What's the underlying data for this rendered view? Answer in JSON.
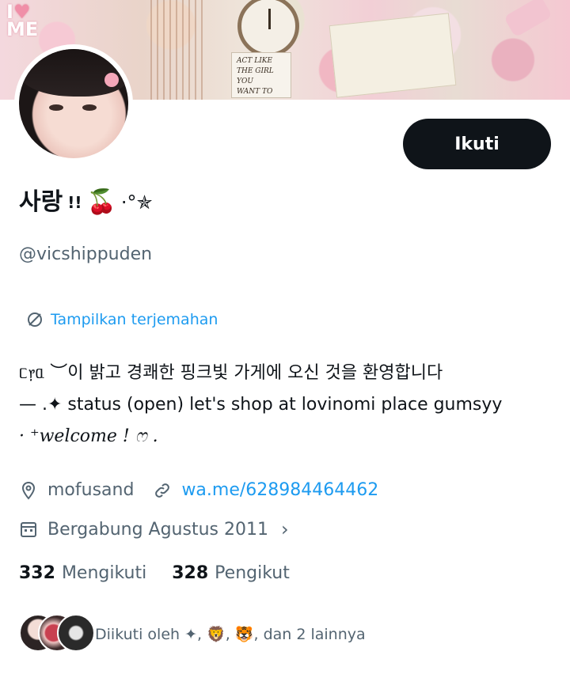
{
  "banner": {
    "clock_card_lines": [
      "ACT LIKE",
      "THE GIRL YOU",
      "WANT TO"
    ],
    "iheart_text": "I",
    "me_text": "ME"
  },
  "profile": {
    "name": "사랑",
    "name_badge": "!!",
    "name_emoji": "🍒",
    "name_tail": "·°✯",
    "handle": "@vicshippuden",
    "follow_label": "Ikuti"
  },
  "translate_label": "Tampilkan terjemahan",
  "bio": {
    "line1": "ᥴ᥅ᥲ ︶이 밝고 경쾌한 핑크빛 가게에 오신 것을 환영합니다",
    "line2": "— .✦ status (open) let's shop at lovinomi place gumsyy",
    "line3": "· ⁺welcome ! ෆ ."
  },
  "meta": {
    "location": "mofusand",
    "link": "wa.me/628984464462",
    "joined": "Bergabung Agustus 2011"
  },
  "stats": {
    "following_count": "332",
    "following_label": "Mengikuti",
    "followers_count": "328",
    "followers_label": "Pengikut"
  },
  "followed_by": "Diikuti oleh ✦, 🦁, 🐯, dan 2 lainnya",
  "icons": {
    "location": "location-pin-icon",
    "link": "link-icon",
    "calendar": "calendar-icon",
    "translate": "translate-icon",
    "chevron": "chevron-right-icon"
  },
  "colors": {
    "accent": "#1d9bf0",
    "text": "#0f1419",
    "muted": "#536471",
    "button": "#0f1419"
  }
}
